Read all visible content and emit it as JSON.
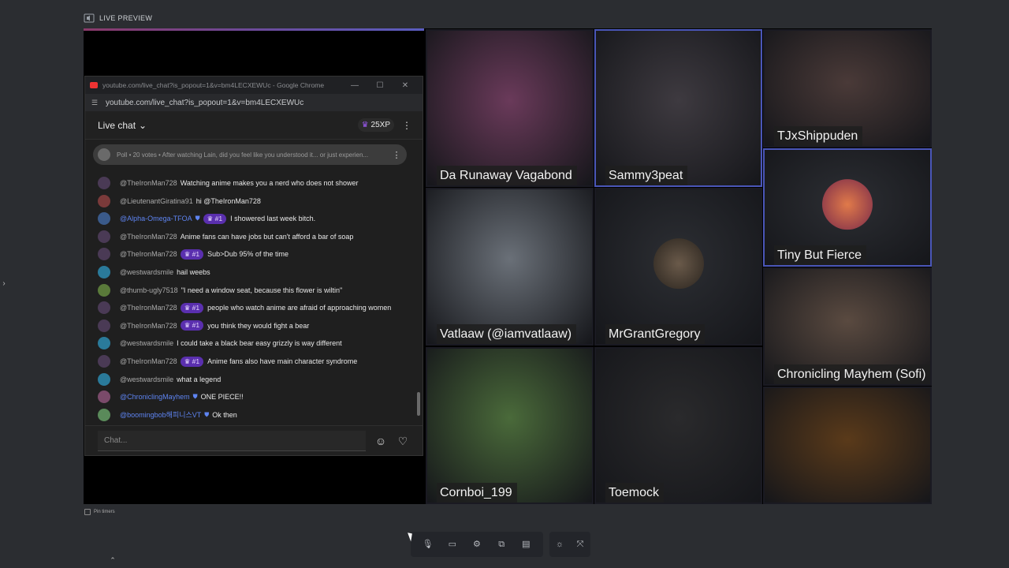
{
  "header": {
    "title": "LIVE PREVIEW"
  },
  "chat_window": {
    "window_title": "youtube.com/live_chat?is_popout=1&v=bm4LECXEWUc - Google Chrome",
    "url": "youtube.com/live_chat?is_popout=1&v=bm4LECXEWUc",
    "mode_label": "Live chat",
    "xp_label": "25XP",
    "poll_text": "Poll • 20 votes • After watching Lain, did you feel like you understood it... or just experien...",
    "input_placeholder": "Chat...",
    "messages": [
      {
        "author": "@TheIronMan728",
        "badge": "",
        "text": "Watching anime makes you a nerd who does not shower",
        "mod": false,
        "avatar_color": "#4a3a55"
      },
      {
        "author": "@LieutenantGiratina91",
        "badge": "",
        "text": "hi @TheIronMan728",
        "mod": false,
        "avatar_color": "#7a3a3a"
      },
      {
        "author": "@Alpha-Omega-TFOA",
        "badge": "#1",
        "text": "I showered last week bitch.",
        "mod": true,
        "avatar_color": "#3a5a8a"
      },
      {
        "author": "@TheIronMan728",
        "badge": "",
        "text": "Anime fans can have jobs but can't afford a bar of soap",
        "mod": false,
        "avatar_color": "#4a3a55"
      },
      {
        "author": "@TheIronMan728",
        "badge": "#1",
        "text": "Sub>Dub 95% of the time",
        "mod": false,
        "avatar_color": "#4a3a55"
      },
      {
        "author": "@westwardsmile",
        "badge": "",
        "text": "hail weebs",
        "mod": false,
        "avatar_color": "#2a7a9a"
      },
      {
        "author": "@thumb-ugly7518",
        "badge": "",
        "text": "\"I need a window seat, because this flower is wiltin\"",
        "mod": false,
        "avatar_color": "#5a7a3a"
      },
      {
        "author": "@TheIronMan728",
        "badge": "#1",
        "text": "people who watch anime are afraid of approaching women",
        "mod": false,
        "avatar_color": "#4a3a55"
      },
      {
        "author": "@TheIronMan728",
        "badge": "#1",
        "text": "you think they would fight a bear",
        "mod": false,
        "avatar_color": "#4a3a55"
      },
      {
        "author": "@westwardsmile",
        "badge": "",
        "text": "I could take a black bear easy grizzly is way different",
        "mod": false,
        "avatar_color": "#2a7a9a"
      },
      {
        "author": "@TheIronMan728",
        "badge": "#1",
        "text": "Anime fans also have main character syndrome",
        "mod": false,
        "avatar_color": "#4a3a55"
      },
      {
        "author": "@westwardsmile",
        "badge": "",
        "text": "what a legend",
        "mod": false,
        "avatar_color": "#2a7a9a"
      },
      {
        "author": "@ChroniclingMayhem",
        "badge": "",
        "text": "ONE PIECE!!",
        "mod": true,
        "avatar_color": "#7a4a6a"
      },
      {
        "author": "@boomingbob해피니스VT",
        "badge": "",
        "text": "Ok then",
        "mod": true,
        "avatar_color": "#5a8a5a"
      }
    ]
  },
  "participants": [
    {
      "name": "Da Runaway Vagabond",
      "bg": "#6a3a5a",
      "active": false
    },
    {
      "name": "Sammy3peat",
      "bg": "#3e3a40",
      "active": true
    },
    {
      "name": "TJxShippuden",
      "bg": "#4a3a38",
      "active": false
    },
    {
      "name": "Vatlaaw (@iamvatlaaw)",
      "bg": "#6a7078",
      "active": false
    },
    {
      "name": "MrGrantGregory",
      "bg": "#2c2e33",
      "active": false
    },
    {
      "name": "Tiny But Fierce",
      "bg": "#2c2e33",
      "active": true
    },
    {
      "name": "Chronicling Mayhem (Sofi)",
      "bg": "#5a4a40",
      "active": false
    },
    {
      "name": "Cornboi_199",
      "bg": "#4a6a3a",
      "active": false
    },
    {
      "name": "Toemock",
      "bg": "#2a2a2c",
      "active": false
    },
    {
      "name": "",
      "bg": "#5a3a1a",
      "active": false
    }
  ],
  "footer": {
    "pin_label": "Pin timers"
  },
  "icons": {
    "mic": "mic-icon",
    "camera": "camera-icon",
    "settings": "gear-icon",
    "screen": "screen-share-icon",
    "layout": "layout-icon",
    "light": "brightness-icon",
    "fullscreen": "fullscreen-icon"
  }
}
